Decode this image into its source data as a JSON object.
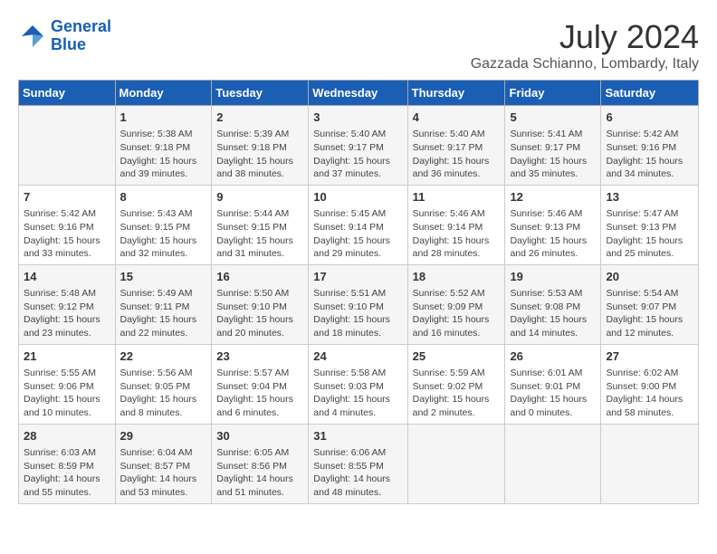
{
  "header": {
    "logo_line1": "General",
    "logo_line2": "Blue",
    "month_year": "July 2024",
    "location": "Gazzada Schianno, Lombardy, Italy"
  },
  "days_of_week": [
    "Sunday",
    "Monday",
    "Tuesday",
    "Wednesday",
    "Thursday",
    "Friday",
    "Saturday"
  ],
  "weeks": [
    [
      {
        "day": "",
        "info": ""
      },
      {
        "day": "1",
        "info": "Sunrise: 5:38 AM\nSunset: 9:18 PM\nDaylight: 15 hours\nand 39 minutes."
      },
      {
        "day": "2",
        "info": "Sunrise: 5:39 AM\nSunset: 9:18 PM\nDaylight: 15 hours\nand 38 minutes."
      },
      {
        "day": "3",
        "info": "Sunrise: 5:40 AM\nSunset: 9:17 PM\nDaylight: 15 hours\nand 37 minutes."
      },
      {
        "day": "4",
        "info": "Sunrise: 5:40 AM\nSunset: 9:17 PM\nDaylight: 15 hours\nand 36 minutes."
      },
      {
        "day": "5",
        "info": "Sunrise: 5:41 AM\nSunset: 9:17 PM\nDaylight: 15 hours\nand 35 minutes."
      },
      {
        "day": "6",
        "info": "Sunrise: 5:42 AM\nSunset: 9:16 PM\nDaylight: 15 hours\nand 34 minutes."
      }
    ],
    [
      {
        "day": "7",
        "info": "Sunrise: 5:42 AM\nSunset: 9:16 PM\nDaylight: 15 hours\nand 33 minutes."
      },
      {
        "day": "8",
        "info": "Sunrise: 5:43 AM\nSunset: 9:15 PM\nDaylight: 15 hours\nand 32 minutes."
      },
      {
        "day": "9",
        "info": "Sunrise: 5:44 AM\nSunset: 9:15 PM\nDaylight: 15 hours\nand 31 minutes."
      },
      {
        "day": "10",
        "info": "Sunrise: 5:45 AM\nSunset: 9:14 PM\nDaylight: 15 hours\nand 29 minutes."
      },
      {
        "day": "11",
        "info": "Sunrise: 5:46 AM\nSunset: 9:14 PM\nDaylight: 15 hours\nand 28 minutes."
      },
      {
        "day": "12",
        "info": "Sunrise: 5:46 AM\nSunset: 9:13 PM\nDaylight: 15 hours\nand 26 minutes."
      },
      {
        "day": "13",
        "info": "Sunrise: 5:47 AM\nSunset: 9:13 PM\nDaylight: 15 hours\nand 25 minutes."
      }
    ],
    [
      {
        "day": "14",
        "info": "Sunrise: 5:48 AM\nSunset: 9:12 PM\nDaylight: 15 hours\nand 23 minutes."
      },
      {
        "day": "15",
        "info": "Sunrise: 5:49 AM\nSunset: 9:11 PM\nDaylight: 15 hours\nand 22 minutes."
      },
      {
        "day": "16",
        "info": "Sunrise: 5:50 AM\nSunset: 9:10 PM\nDaylight: 15 hours\nand 20 minutes."
      },
      {
        "day": "17",
        "info": "Sunrise: 5:51 AM\nSunset: 9:10 PM\nDaylight: 15 hours\nand 18 minutes."
      },
      {
        "day": "18",
        "info": "Sunrise: 5:52 AM\nSunset: 9:09 PM\nDaylight: 15 hours\nand 16 minutes."
      },
      {
        "day": "19",
        "info": "Sunrise: 5:53 AM\nSunset: 9:08 PM\nDaylight: 15 hours\nand 14 minutes."
      },
      {
        "day": "20",
        "info": "Sunrise: 5:54 AM\nSunset: 9:07 PM\nDaylight: 15 hours\nand 12 minutes."
      }
    ],
    [
      {
        "day": "21",
        "info": "Sunrise: 5:55 AM\nSunset: 9:06 PM\nDaylight: 15 hours\nand 10 minutes."
      },
      {
        "day": "22",
        "info": "Sunrise: 5:56 AM\nSunset: 9:05 PM\nDaylight: 15 hours\nand 8 minutes."
      },
      {
        "day": "23",
        "info": "Sunrise: 5:57 AM\nSunset: 9:04 PM\nDaylight: 15 hours\nand 6 minutes."
      },
      {
        "day": "24",
        "info": "Sunrise: 5:58 AM\nSunset: 9:03 PM\nDaylight: 15 hours\nand 4 minutes."
      },
      {
        "day": "25",
        "info": "Sunrise: 5:59 AM\nSunset: 9:02 PM\nDaylight: 15 hours\nand 2 minutes."
      },
      {
        "day": "26",
        "info": "Sunrise: 6:01 AM\nSunset: 9:01 PM\nDaylight: 15 hours\nand 0 minutes."
      },
      {
        "day": "27",
        "info": "Sunrise: 6:02 AM\nSunset: 9:00 PM\nDaylight: 14 hours\nand 58 minutes."
      }
    ],
    [
      {
        "day": "28",
        "info": "Sunrise: 6:03 AM\nSunset: 8:59 PM\nDaylight: 14 hours\nand 55 minutes."
      },
      {
        "day": "29",
        "info": "Sunrise: 6:04 AM\nSunset: 8:57 PM\nDaylight: 14 hours\nand 53 minutes."
      },
      {
        "day": "30",
        "info": "Sunrise: 6:05 AM\nSunset: 8:56 PM\nDaylight: 14 hours\nand 51 minutes."
      },
      {
        "day": "31",
        "info": "Sunrise: 6:06 AM\nSunset: 8:55 PM\nDaylight: 14 hours\nand 48 minutes."
      },
      {
        "day": "",
        "info": ""
      },
      {
        "day": "",
        "info": ""
      },
      {
        "day": "",
        "info": ""
      }
    ]
  ]
}
